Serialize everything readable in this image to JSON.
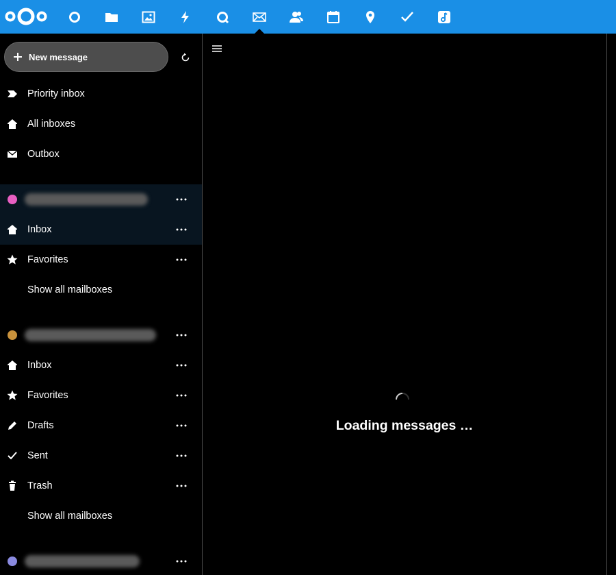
{
  "header": {
    "apps": [
      {
        "name": "dashboard-icon"
      },
      {
        "name": "folder-icon"
      },
      {
        "name": "photos-icon"
      },
      {
        "name": "activity-icon"
      },
      {
        "name": "talk-icon"
      },
      {
        "name": "mail-icon",
        "active": true
      },
      {
        "name": "contacts-icon"
      },
      {
        "name": "calendar-icon"
      },
      {
        "name": "maps-icon"
      },
      {
        "name": "tasks-icon"
      },
      {
        "name": "music-icon"
      }
    ],
    "accent": "#1a8fe6"
  },
  "sidebar": {
    "new_message_label": "New message",
    "unified": [
      {
        "label": "Priority inbox",
        "icon": "priority-icon"
      },
      {
        "label": "All inboxes",
        "icon": "home-icon"
      },
      {
        "label": "Outbox",
        "icon": "outbox-icon"
      }
    ],
    "accounts": [
      {
        "color": "#e85fc2",
        "items": [
          {
            "label": "Inbox",
            "icon": "home-icon"
          },
          {
            "label": "Favorites",
            "icon": "star-icon"
          }
        ],
        "show_all": "Show all mailboxes"
      },
      {
        "color": "#c9923c",
        "items": [
          {
            "label": "Inbox",
            "icon": "home-icon"
          },
          {
            "label": "Favorites",
            "icon": "star-icon"
          },
          {
            "label": "Drafts",
            "icon": "pencil-icon"
          },
          {
            "label": "Sent",
            "icon": "check-icon"
          },
          {
            "label": "Trash",
            "icon": "trash-icon"
          }
        ],
        "show_all": "Show all mailboxes"
      },
      {
        "color": "#8a8ae0"
      }
    ]
  },
  "main": {
    "loading_text": "Loading messages …"
  }
}
